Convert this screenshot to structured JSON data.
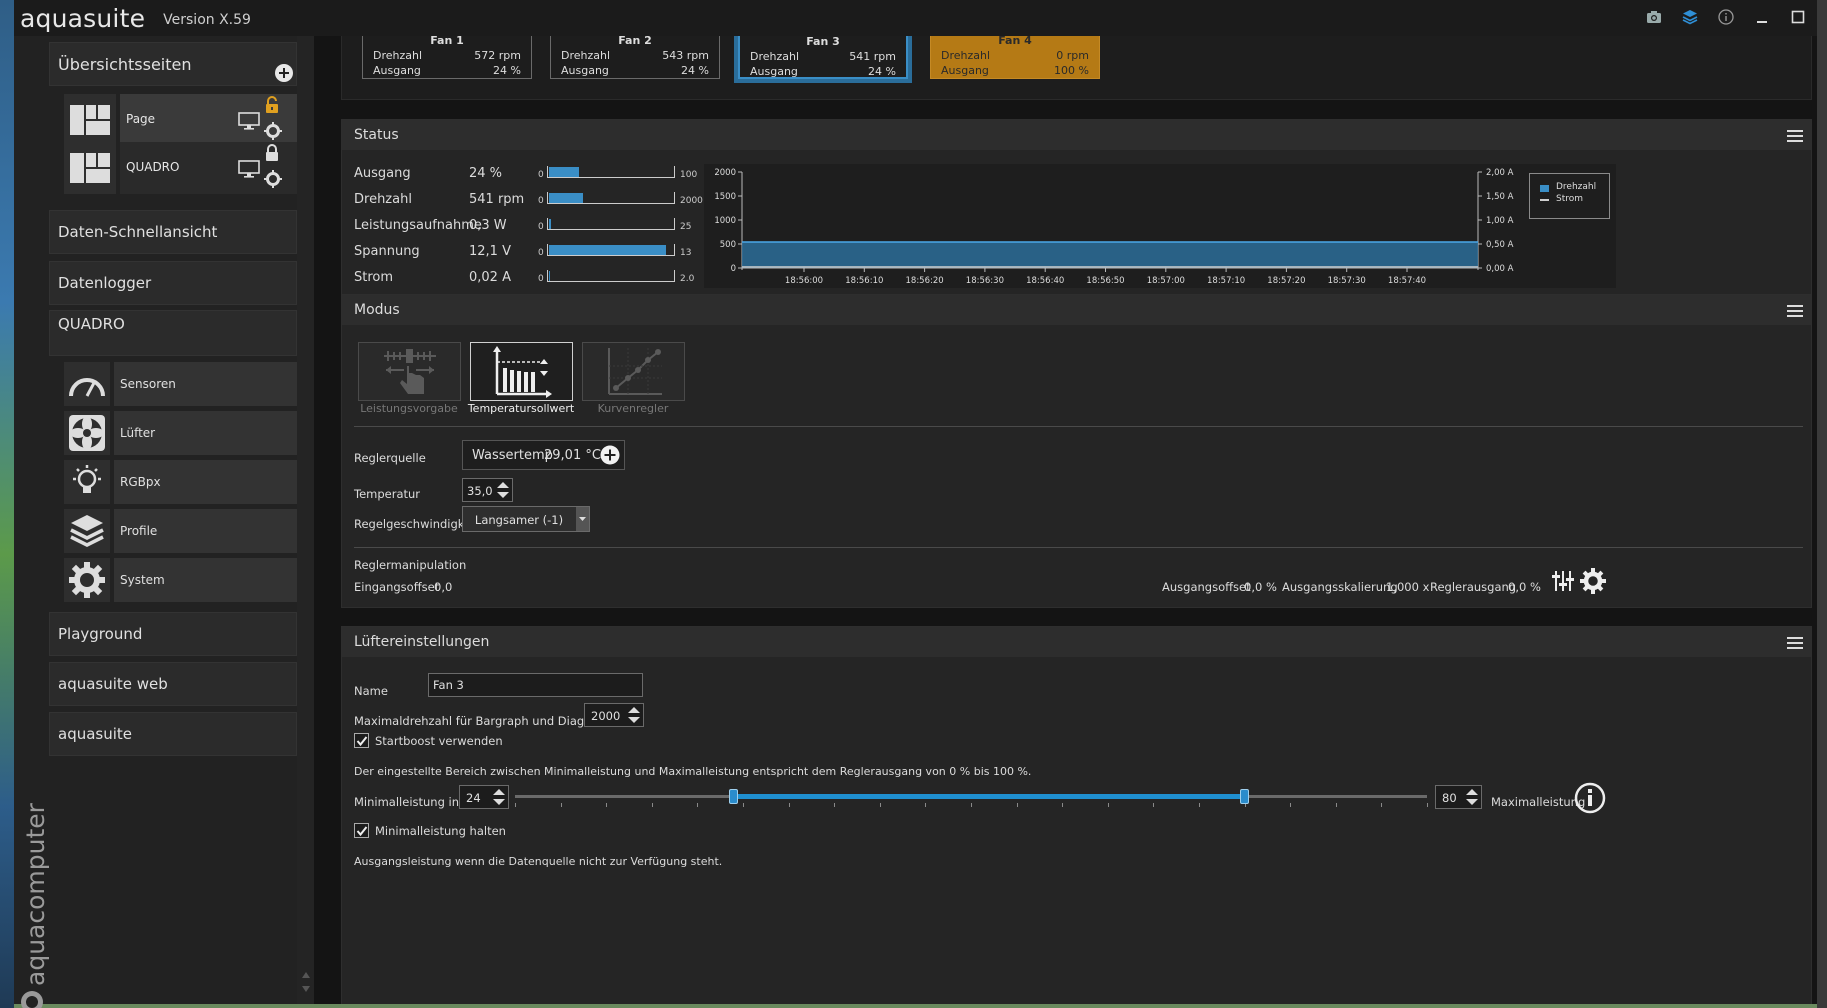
{
  "app": {
    "name": "aquasuite",
    "version": "Version X.59",
    "brand_vertical": "aquacomputer"
  },
  "titlebar_icons": [
    "camera-icon",
    "layers-icon",
    "info-icon",
    "minimize-icon",
    "maximize-icon"
  ],
  "sidebar": {
    "overview_title": "Übersichtsseiten",
    "pages": [
      {
        "label": "Page",
        "locked": true
      },
      {
        "label": "QUADRO",
        "locked": true
      }
    ],
    "items": [
      {
        "label": "Daten-Schnellansicht"
      },
      {
        "label": "Datenlogger"
      },
      {
        "label": "QUADRO"
      }
    ],
    "device_items": [
      {
        "label": "Sensoren",
        "icon": "gauge-icon"
      },
      {
        "label": "Lüfter",
        "icon": "fan-icon"
      },
      {
        "label": "RGBpx",
        "icon": "bulb-icon"
      },
      {
        "label": "Profile",
        "icon": "layers-icon"
      },
      {
        "label": "System",
        "icon": "gear-icon"
      }
    ],
    "bottom_items": [
      {
        "label": "Playground"
      },
      {
        "label": "aquasuite web"
      },
      {
        "label": "aquasuite"
      }
    ]
  },
  "fans": [
    {
      "name": "Fan 1",
      "speed_label": "Drehzahl",
      "speed": "572 rpm",
      "output_label": "Ausgang",
      "output": "24 %"
    },
    {
      "name": "Fan 2",
      "speed_label": "Drehzahl",
      "speed": "543 rpm",
      "output_label": "Ausgang",
      "output": "24 %"
    },
    {
      "name": "Fan 3",
      "speed_label": "Drehzahl",
      "speed": "541 rpm",
      "output_label": "Ausgang",
      "output": "24 %"
    },
    {
      "name": "Fan 4",
      "speed_label": "Drehzahl",
      "speed": "0 rpm",
      "output_label": "Ausgang",
      "output": "100 %"
    }
  ],
  "status": {
    "title": "Status",
    "rows": [
      {
        "label": "Ausgang",
        "value": "24 %",
        "min": "0",
        "max": "100",
        "fraction": 0.24
      },
      {
        "label": "Drehzahl",
        "value": "541 rpm",
        "min": "0",
        "max": "2000",
        "fraction": 0.2705
      },
      {
        "label": "Leistungsaufnahme",
        "value": "0,3 W",
        "min": "0",
        "max": "25",
        "fraction": 0.012
      },
      {
        "label": "Spannung",
        "value": "12,1 V",
        "min": "0",
        "max": "13",
        "fraction": 0.93
      },
      {
        "label": "Strom",
        "value": "0,02 A",
        "min": "0",
        "max": "2.0",
        "fraction": 0.01
      }
    ]
  },
  "chart_data": {
    "type": "area",
    "x": [
      "18:56:00",
      "18:56:10",
      "18:56:20",
      "18:56:30",
      "18:56:40",
      "18:56:50",
      "18:57:00",
      "18:57:10",
      "18:57:20",
      "18:57:30",
      "18:57:40"
    ],
    "y_left_ticks": [
      "2000",
      "1500",
      "1000",
      "500",
      "0"
    ],
    "y_right_ticks": [
      "2,00 A",
      "1,50 A",
      "1,00 A",
      "0,50 A",
      "0,00 A"
    ],
    "ylim_left": [
      0,
      2000
    ],
    "ylim_right": [
      0,
      2.0
    ],
    "series": [
      {
        "name": "Drehzahl",
        "values": [
          541,
          541,
          541,
          541,
          541,
          541,
          541,
          541,
          541,
          541,
          541
        ],
        "color": "#3a8ec6"
      },
      {
        "name": "Strom",
        "values": [
          0.02,
          0.02,
          0.02,
          0.02,
          0.02,
          0.02,
          0.02,
          0.02,
          0.02,
          0.02,
          0.02
        ],
        "color": "#cfcfcf"
      }
    ],
    "legend": "top-right",
    "grid": false
  },
  "mode": {
    "title": "Modus",
    "options": [
      {
        "label": "Leistungsvorgabe",
        "active": false
      },
      {
        "label": "Temperatursollwert",
        "active": true
      },
      {
        "label": "Kurvenregler",
        "active": false
      }
    ],
    "source_label": "Reglerquelle",
    "source_name": "Wassertemp",
    "source_value": "29,01 °C",
    "temp_label": "Temperatur",
    "temp_value": "35,0",
    "speed_label": "Regelgeschwindigkeit",
    "speed_value": "Langsamer (-1)",
    "manip_title": "Reglermanipulation",
    "input_offset_label": "Eingangsoffset",
    "input_offset_value": "0,0",
    "output_offset_label": "Ausgangsoffset",
    "output_offset_value": "0,0 %",
    "output_scale_label": "Ausgangsskalierung",
    "output_scale_value": "1,000 x",
    "controller_output_label": "Reglerausgang",
    "controller_output_value": "0,0 %"
  },
  "fan_settings": {
    "title": "Lüftereinstellungen",
    "name_label": "Name",
    "name_value": "Fan 3",
    "maxrpm_label": "Maximaldrehzahl für Bargraph und Diagramm",
    "maxrpm_value": "2000",
    "startboost_label": "Startboost verwenden",
    "startboost_checked": true,
    "range_note": "Der eingestellte Bereich zwischen Minimalleistung und Maximalleistung entspricht dem Reglerausgang von 0 % bis 100 %.",
    "min_label": "Minimalleistung in %",
    "min_value": "24",
    "max_value": "80",
    "max_label": "Maximalleistung",
    "slider_min_fraction": 0.24,
    "slider_max_fraction": 0.8,
    "hold_min_label": "Minimalleistung halten",
    "hold_min_checked": true,
    "fallback_note": "Ausgangsleistung wenn die Datenquelle nicht zur Verfügung steht."
  },
  "colors": {
    "accent": "#3a8ec6",
    "warning": "#b57a15",
    "lock": "#e0a020"
  }
}
